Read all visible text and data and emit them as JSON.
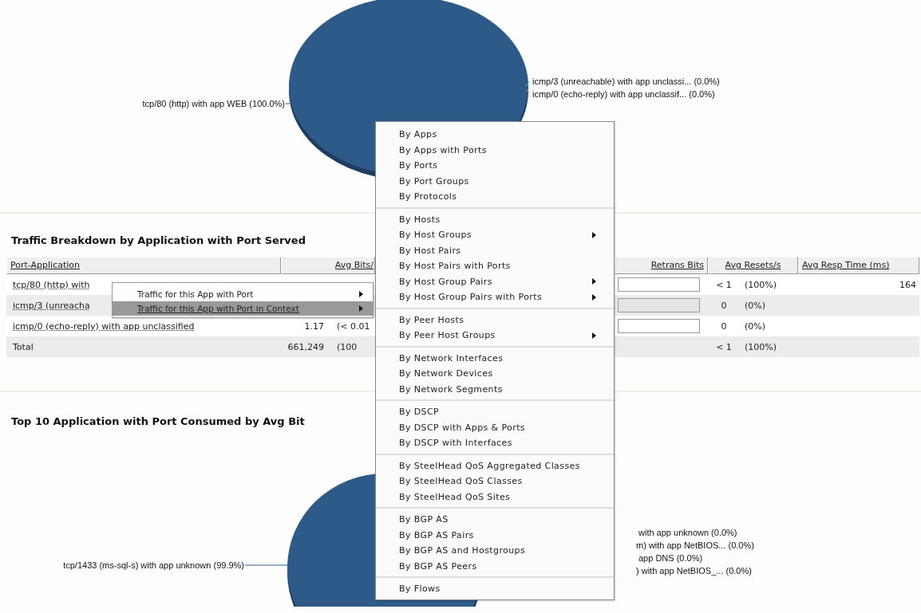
{
  "top_chart": {
    "left_labels": [
      "tcp/80 (http) with app WEB (100.0%)"
    ],
    "right_labels": [
      "icmp/3 (unreachable) with app unclassi... (0.0%)",
      "icmp/0 (echo-reply) with app unclassif... (0.0%)"
    ]
  },
  "breakdown": {
    "title": "Traffic Breakdown by Application with Port Served",
    "columns": [
      {
        "label": "Port-Application"
      },
      {
        "label": "Avg Bits/"
      },
      {
        "label": "Retrans Bits"
      },
      {
        "label": "Avg Resets/s"
      },
      {
        "label": "Avg Resp Time (ms)"
      }
    ],
    "rows": [
      {
        "kind": "data",
        "application": "tcp/80 (http) with",
        "level": 0,
        "resets": "< 1",
        "resets_pct": "(100%)",
        "resp_time": "164"
      },
      {
        "kind": "data",
        "application": "icmp/3 (unreacha",
        "level": 0,
        "resets": "0",
        "resets_pct": "(0%)"
      },
      {
        "kind": "data",
        "application": "icmp/0 (echo-reply) with app unclassified",
        "avg_bits": "1.17",
        "avg_bits_pct": "(< 0.01",
        "level": 0,
        "resets": "0",
        "resets_pct": "(0%)"
      },
      {
        "kind": "total",
        "application": "Total",
        "avg_bits": "661,249",
        "avg_bits_pct": "(100",
        "resets": "< 1",
        "resets_pct": "(100%)"
      }
    ]
  },
  "top10": {
    "title": "Top 10 Application with Port Consumed by Avg Bit",
    "left_labels": [
      "tcp/1433 (ms-sql-s) with app unknown (99.9%)"
    ],
    "right_labels": [
      "with app unknown (0.0%)",
      "m) with app NetBIOS... (0.0%)",
      "app DNS (0.0%)",
      ") with app NetBIOS_... (0.0%)"
    ]
  },
  "submenu": {
    "items": [
      {
        "label": "Traffic for this App with Port",
        "submenu": true,
        "selected": false
      },
      {
        "label": "Traffic for this App with Port in Context",
        "submenu": true,
        "selected": true
      }
    ]
  },
  "context_menu": {
    "groups": [
      [
        {
          "label": "By Apps",
          "submenu": false
        },
        {
          "label": "By Apps with Ports",
          "submenu": false
        },
        {
          "label": "By Ports",
          "submenu": false
        },
        {
          "label": "By Port Groups",
          "submenu": false
        },
        {
          "label": "By Protocols",
          "submenu": false
        }
      ],
      [
        {
          "label": "By Hosts",
          "submenu": false
        },
        {
          "label": "By Host Groups",
          "submenu": true
        },
        {
          "label": "By Host Pairs",
          "submenu": false
        },
        {
          "label": "By Host Pairs with Ports",
          "submenu": false
        },
        {
          "label": "By Host Group Pairs",
          "submenu": true
        },
        {
          "label": "By Host Group Pairs with Ports",
          "submenu": true
        }
      ],
      [
        {
          "label": "By Peer Hosts",
          "submenu": false
        },
        {
          "label": "By Peer Host Groups",
          "submenu": true
        }
      ],
      [
        {
          "label": "By Network Interfaces",
          "submenu": false
        },
        {
          "label": "By Network Devices",
          "submenu": false
        },
        {
          "label": "By Network Segments",
          "submenu": false
        }
      ],
      [
        {
          "label": "By DSCP",
          "submenu": false
        },
        {
          "label": "By DSCP with Apps & Ports",
          "submenu": false
        },
        {
          "label": "By DSCP with Interfaces",
          "submenu": false
        }
      ],
      [
        {
          "label": "By SteelHead QoS Aggregated Classes",
          "submenu": false
        },
        {
          "label": "By SteelHead QoS Classes",
          "submenu": false
        },
        {
          "label": "By SteelHead QoS Sites",
          "submenu": false
        }
      ],
      [
        {
          "label": "By BGP AS",
          "submenu": false
        },
        {
          "label": "By BGP AS Pairs",
          "submenu": false
        },
        {
          "label": "By BGP AS and Hostgroups",
          "submenu": false
        },
        {
          "label": "By BGP AS Peers",
          "submenu": false
        }
      ],
      [
        {
          "label": "By Flows",
          "submenu": false
        }
      ]
    ]
  }
}
